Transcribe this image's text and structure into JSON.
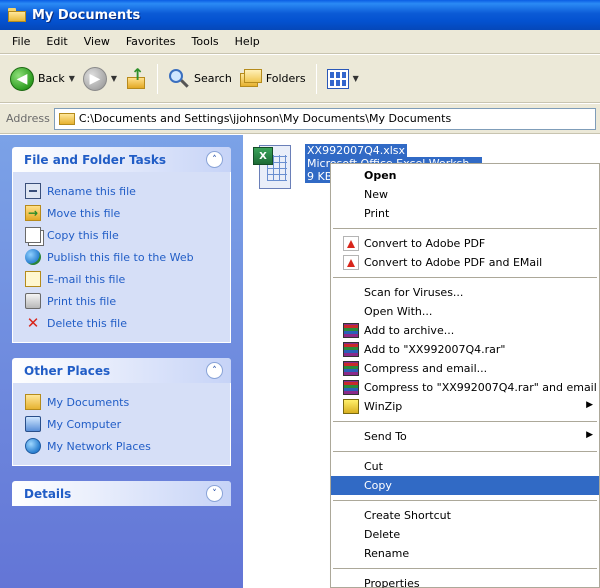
{
  "window": {
    "title": "My Documents"
  },
  "menubar": {
    "items": [
      "File",
      "Edit",
      "View",
      "Favorites",
      "Tools",
      "Help"
    ]
  },
  "toolbar": {
    "back_label": "Back",
    "search_label": "Search",
    "folders_label": "Folders"
  },
  "address": {
    "label": "Address",
    "path": "C:\\Documents and Settings\\jjohnson\\My Documents\\My Documents"
  },
  "taskpane": {
    "file_tasks": {
      "title": "File and Folder Tasks",
      "items": [
        {
          "label": "Rename this file",
          "icon": "rename-icon"
        },
        {
          "label": "Move this file",
          "icon": "move-icon"
        },
        {
          "label": "Copy this file",
          "icon": "copy-icon"
        },
        {
          "label": "Publish this file to the Web",
          "icon": "web-icon"
        },
        {
          "label": "E-mail this file",
          "icon": "email-icon"
        },
        {
          "label": "Print this file",
          "icon": "printer-icon"
        },
        {
          "label": "Delete this file",
          "icon": "delete-icon"
        }
      ]
    },
    "other_places": {
      "title": "Other Places",
      "items": [
        {
          "label": "My Documents",
          "icon": "my-documents-icon"
        },
        {
          "label": "My Computer",
          "icon": "my-computer-icon"
        },
        {
          "label": "My Network Places",
          "icon": "network-places-icon"
        }
      ]
    },
    "details": {
      "title": "Details"
    }
  },
  "file": {
    "name": "XX992007Q4.xlsx",
    "type": "Microsoft Office Excel Worksh...",
    "size": "9 KB"
  },
  "context_menu": {
    "open": "Open",
    "new": "New",
    "print": "Print",
    "convert_pdf": "Convert to Adobe PDF",
    "convert_pdf_email": "Convert to Adobe PDF and EMail",
    "scan": "Scan for Viruses...",
    "open_with": "Open With...",
    "add_archive": "Add to archive...",
    "add_rar": "Add to \"XX992007Q4.rar\"",
    "compress_email": "Compress and email...",
    "compress_rar_email": "Compress to \"XX992007Q4.rar\" and email",
    "winzip": "WinZip",
    "send_to": "Send To",
    "cut": "Cut",
    "copy": "Copy",
    "create_shortcut": "Create Shortcut",
    "delete": "Delete",
    "rename": "Rename",
    "properties": "Properties"
  },
  "colors": {
    "title_bar": "#0a5de4",
    "task_link": "#215dc6",
    "selection": "#316ac5",
    "pane_bg": "#7ba2e7"
  }
}
